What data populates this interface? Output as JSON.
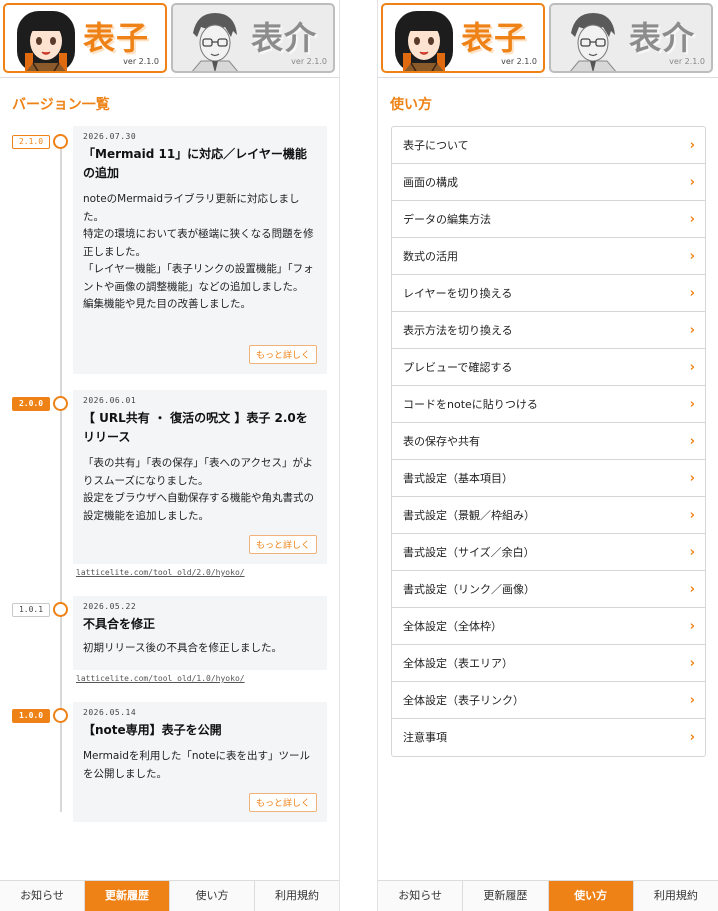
{
  "brand": {
    "active_name": "表子",
    "active_version": "ver 2.1.0",
    "inactive_name": "表介",
    "inactive_version": "ver 2.1.0"
  },
  "colors": {
    "accent": "#ef8216",
    "card_bg": "#f3f5f7",
    "border": "#d6d6d6"
  },
  "left": {
    "section_title": "バージョン一覧",
    "versions": [
      {
        "badge": "2.1.0",
        "date": "2026.07.30",
        "title": "「Mermaid 11」に対応／レイヤー機能の追加",
        "body": "noteのMermaidライブラリ更新に対応しました。\n特定の環境において表が極端に狭くなる問題を修正しました。\n「レイヤー機能」「表子リンクの設置機能」「フォントや画像の調整機能」などの追加しました。\n編集機能や見た目の改善しました。",
        "more": "もっと詳しく",
        "link": ""
      },
      {
        "badge": "2.0.0",
        "date": "2026.06.01",
        "title": "【 URL共有 ・ 復活の呪文 】表子 2.0をリリース",
        "body": "「表の共有」「表の保存」「表へのアクセス」がよりスムーズになりました。\n設定をブラウザへ自動保存する機能や角丸書式の設定機能を追加しました。",
        "more": "もっと詳しく",
        "link": "latticelite.com/tool_old/2.0/hyoko/"
      },
      {
        "badge": "1.0.1",
        "date": "2026.05.22",
        "title": "不具合を修正",
        "body": "初期リリース後の不具合を修正しました。",
        "more": "",
        "link": "latticelite.com/tool_old/1.0/hyoko/"
      },
      {
        "badge": "1.0.0",
        "date": "2026.05.14",
        "title": "【note専用】表子を公開",
        "body": "Mermaidを利用した「noteに表を出す」ツールを公開しました。",
        "more": "もっと詳しく",
        "link": ""
      }
    ]
  },
  "right": {
    "section_title": "使い方",
    "items": [
      "表子について",
      "画面の構成",
      "データの編集方法",
      "数式の活用",
      "レイヤーを切り換える",
      "表示方法を切り換える",
      "プレビューで確認する",
      "コードをnoteに貼りつける",
      "表の保存や共有",
      "書式設定（基本項目）",
      "書式設定（景観／枠組み）",
      "書式設定（サイズ／余白）",
      "書式設定（リンク／画像）",
      "全体設定（全体枠）",
      "全体設定（表エリア）",
      "全体設定（表子リンク）",
      "注意事項"
    ],
    "chevron": "›"
  },
  "nav": {
    "tabs": [
      "お知らせ",
      "更新履歴",
      "使い方",
      "利用規約"
    ],
    "left_active": "更新履歴",
    "right_active": "使い方"
  }
}
